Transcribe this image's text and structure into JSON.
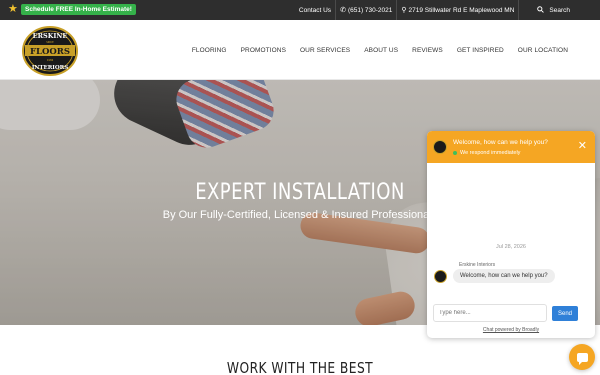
{
  "topbar": {
    "cta_label": "Schedule FREE In-Home Estimate!",
    "contact_label": "Contact Us",
    "phone": "(651) 730-2021",
    "address": "2719 Stillwater Rd E Maplewood MN",
    "search_label": "Search"
  },
  "logo": {
    "line1": "ERSKINE",
    "line2": "FLOORS",
    "line3": "INTERIORS",
    "since": "SINCE",
    "year": "1986"
  },
  "nav": {
    "items": [
      "FLOORING",
      "PROMOTIONS",
      "OUR SERVICES",
      "ABOUT US",
      "REVIEWS",
      "GET INSPIRED",
      "OUR LOCATION"
    ]
  },
  "hero": {
    "title": "EXPERT INSTALLATION",
    "subtitle": "By Our Fully-Certified, Licensed & Insured Professionals"
  },
  "section": {
    "title": "WORK WITH THE BEST"
  },
  "chat": {
    "welcome": "Welcome, how can we help you?",
    "status": "We respond immediately",
    "date": "Jul 28, 2026",
    "agent_name": "Erskine Interiors",
    "message": "Welcome, how can we help you?",
    "input_placeholder": "Type here...",
    "send_label": "Send",
    "powered_by": "Chat powered by Broadly"
  },
  "colors": {
    "topbar_bg": "#2e2e2e",
    "cta_green": "#35b24a",
    "chat_accent": "#f5a623",
    "send_blue": "#2f80d8"
  }
}
